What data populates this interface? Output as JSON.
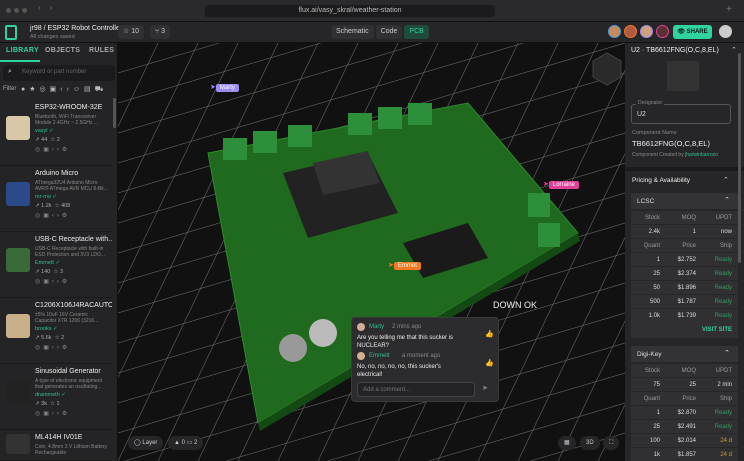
{
  "browser": {
    "url": "flux.ai/vasy_skral/weather-station"
  },
  "header": {
    "project": "jr98 / ESP32 Robot Controller",
    "status": "All changes saved",
    "stars": "10",
    "forks": "3",
    "views": [
      "Schematic",
      "Code",
      "PCB"
    ],
    "share": "SHARE"
  },
  "left": {
    "tabs": [
      "LIBRARY",
      "OBJECTS",
      "RULES"
    ],
    "search_placeholder": "Keyword or part number",
    "filter_label": "Filter",
    "items": [
      {
        "name": "ESP32-WROOM-32E",
        "desc": "Bluetooth, WiFi Transceiver Module 2.4GHz ~ 2.5GHz ...",
        "author": "vasyl",
        "views": "44",
        "stars": "2"
      },
      {
        "name": "Arduino Micro",
        "desc": "ATmega32U4 Arduino Micro AVR® ATmega AVR MCU 8-Bit...",
        "author": "mr-mo",
        "views": "1.2k",
        "stars": "408"
      },
      {
        "name": "USB-C Receptacle with...",
        "desc": "USB-C Receptacle with built-in ESD Protection and 3V3 LDO...",
        "author": "Emmett",
        "views": "140",
        "stars": "3"
      },
      {
        "name": "C1206X106J4RACAUTO",
        "desc": "±5% 10uF 16V Ceramic Capacitor X7R 1206 (3216...",
        "author": "brooks",
        "views": "5.6k",
        "stars": "2"
      },
      {
        "name": "Sinusoidal Generator",
        "desc": "A type of electronic equipment that generates an oscillating...",
        "author": "drammeth",
        "views": "3k",
        "stars": "1"
      },
      {
        "name": "ML414H IV01E",
        "desc": "Coin, 4.8mm 3 V Lithium Battery Rechargeable",
        "author": "",
        "views": "",
        "stars": ""
      }
    ]
  },
  "canvas": {
    "cursors": [
      {
        "name": "Marty",
        "color": "#9a8cf0"
      },
      {
        "name": "Lorraine",
        "color": "#e0409a"
      },
      {
        "name": "Emmet",
        "color": "#f07a20"
      }
    ],
    "comments": [
      {
        "author": "Marty",
        "time": "2 mins ago",
        "text": "Are you telling me that this sucker is NUCLEAR?"
      },
      {
        "author": "Emmett",
        "time": "a moment ago",
        "text": "No, no, no, no, no, this sucker's electrical!"
      }
    ],
    "comment_placeholder": "Add a comment...",
    "layer": "Layer",
    "warnings": "0",
    "comment_count": "2",
    "mode_3d": "3D"
  },
  "right": {
    "title": "U2 · TB6612FNG(O,C,8,EL)",
    "designator_label": "Designator",
    "designator": "U2",
    "name_label": "Component Name",
    "name": "TB6612FNG(O,C,8,EL)",
    "created_by": "Component Created by",
    "creator": "jharwinbarrozo",
    "pricing": "Pricing & Availability",
    "suppliers": [
      {
        "name": "LCSC",
        "stock": "2.4k",
        "moq": "1",
        "updt": "now",
        "rows": [
          [
            "1",
            "$2.752",
            "Ready"
          ],
          [
            "25",
            "$2.374",
            "Ready"
          ],
          [
            "50",
            "$1.896",
            "Ready"
          ],
          [
            "500",
            "$1.787",
            "Ready"
          ],
          [
            "1.0k",
            "$1.739",
            "Ready"
          ]
        ],
        "visit": "VISIT SITE"
      },
      {
        "name": "Digi-Key",
        "stock": "75",
        "moq": "25",
        "updt": "2 min",
        "rows": [
          [
            "1",
            "$2.870",
            "Ready"
          ],
          [
            "25",
            "$2.491",
            "Ready"
          ],
          [
            "100",
            "$2.014",
            "24 d"
          ],
          [
            "1k",
            "$1.857",
            "24 d"
          ]
        ]
      }
    ],
    "headers": {
      "stock": "Stock",
      "moq": "MOQ",
      "updt": "UPDT",
      "quant": "Quant",
      "price": "Price",
      "ship": "Ship"
    }
  },
  "colors": {
    "accent": "#2fd3a0",
    "pcb": "#1f6a1f"
  }
}
